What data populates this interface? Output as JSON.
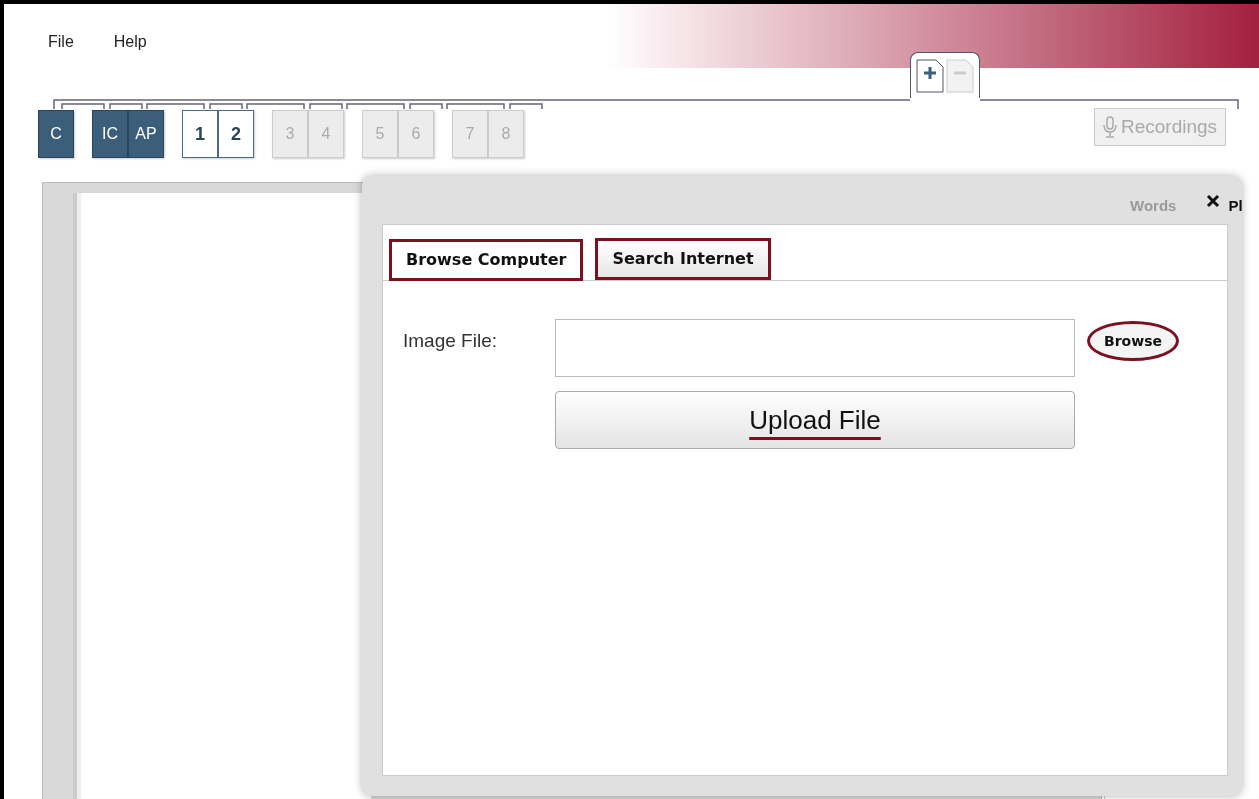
{
  "menu": [
    "File",
    "Help"
  ],
  "page_buttons": [
    {
      "kind": "add",
      "disabled": false
    },
    {
      "kind": "remove",
      "disabled": true
    }
  ],
  "page_tab_groups": [
    [
      {
        "label": "C",
        "kind": "section",
        "disabled": false
      }
    ],
    [
      {
        "label": "IC",
        "kind": "section",
        "disabled": false
      },
      {
        "label": "AP",
        "kind": "section",
        "disabled": false
      }
    ],
    [
      {
        "label": "1",
        "kind": "page",
        "disabled": false
      },
      {
        "label": "2",
        "kind": "page",
        "disabled": false
      }
    ],
    [
      {
        "label": "3",
        "kind": "page",
        "disabled": true
      },
      {
        "label": "4",
        "kind": "page",
        "disabled": true
      }
    ],
    [
      {
        "label": "5",
        "kind": "page",
        "disabled": true
      },
      {
        "label": "6",
        "kind": "page",
        "disabled": true
      }
    ],
    [
      {
        "label": "7",
        "kind": "page",
        "disabled": true
      },
      {
        "label": "8",
        "kind": "page",
        "disabled": true
      }
    ]
  ],
  "recordings_button": {
    "label": "Recordings",
    "disabled": true
  },
  "side_panel": {
    "tab_1": "Words",
    "tab_2": "Pl"
  },
  "dialog": {
    "tabs": [
      {
        "label": "Browse Computer",
        "selected": true,
        "highlighted": true
      },
      {
        "label": "Search Internet",
        "selected": false,
        "highlighted": true
      }
    ],
    "field_label": "Image File:",
    "browse_button": {
      "label": "Browse",
      "highlighted": true
    },
    "upload_button": {
      "label": "Upload File",
      "underlined": true
    }
  }
}
